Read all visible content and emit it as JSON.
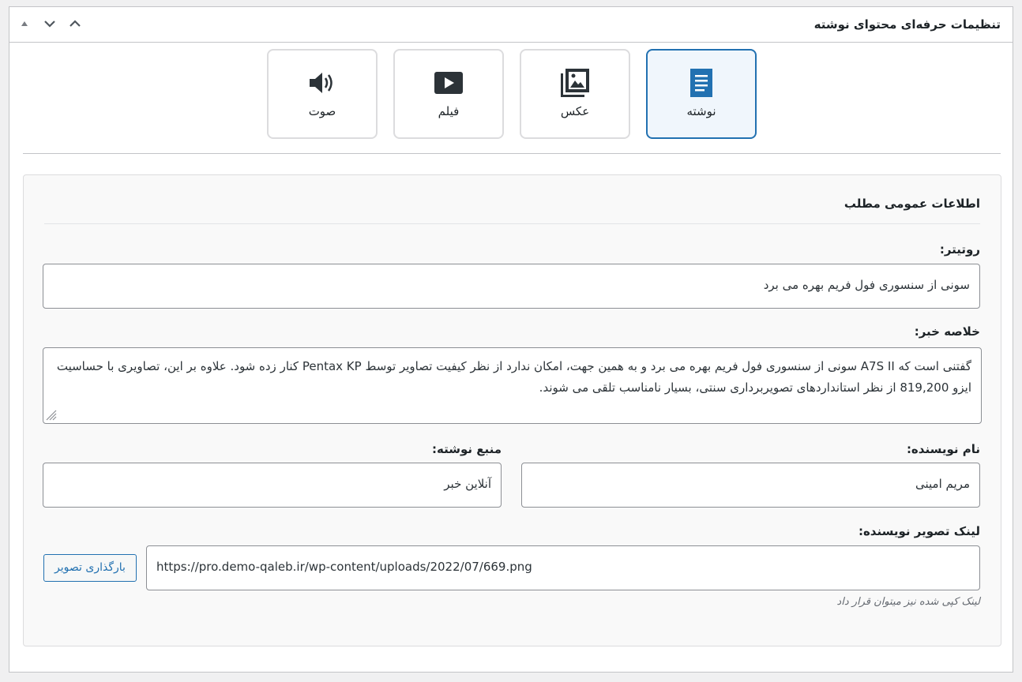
{
  "metabox": {
    "title": "تنظیمات حرفه‌ای محتوای نوشته",
    "controls": [
      "triangle-up-icon",
      "chevron-down-icon",
      "chevron-up-icon"
    ]
  },
  "tabs": [
    {
      "id": "post",
      "label": "نوشته",
      "icon": "document-icon",
      "active": true
    },
    {
      "id": "photo",
      "label": "عکس",
      "icon": "gallery-icon",
      "active": false
    },
    {
      "id": "video",
      "label": "فیلم",
      "icon": "video-play-icon",
      "active": false
    },
    {
      "id": "audio",
      "label": "صوت",
      "icon": "speaker-icon",
      "active": false
    }
  ],
  "section": {
    "title": "اطلاعات عمومی مطلب",
    "kicker": {
      "label": "روتیتر:",
      "value": "سونی از سنسوری فول فریم بهره می برد"
    },
    "summary": {
      "label": "خلاصه خبر:",
      "value": "گفتنی است که A7S II سونی از سنسوری فول فریم بهره می برد و به همین جهت، امکان ندارد از نظر کیفیت تصاویر توسط Pentax KP کنار زده شود. علاوه بر این، تصاویری با حساسیت ایزو 819,200 از نظر استانداردهای تصویربرداری سنتی، بسیار نامناسب تلقی می شوند."
    },
    "author": {
      "label": "نام نویسنده:",
      "value": "مریم امینی"
    },
    "source": {
      "label": "منبع نوشته:",
      "value": "آنلاین خبر"
    },
    "author_image": {
      "label": "لینک تصویر نویسنده:",
      "value": "https://pro.demo-qaleb.ir/wp-content/uploads/2022/07/669.png",
      "button": "بارگذاری تصویر",
      "hint": "لینک کپی شده نیز میتوان قرار داد"
    }
  },
  "colors": {
    "accent": "#2271b1",
    "border": "#c3c4c7",
    "text": "#1d2327"
  }
}
